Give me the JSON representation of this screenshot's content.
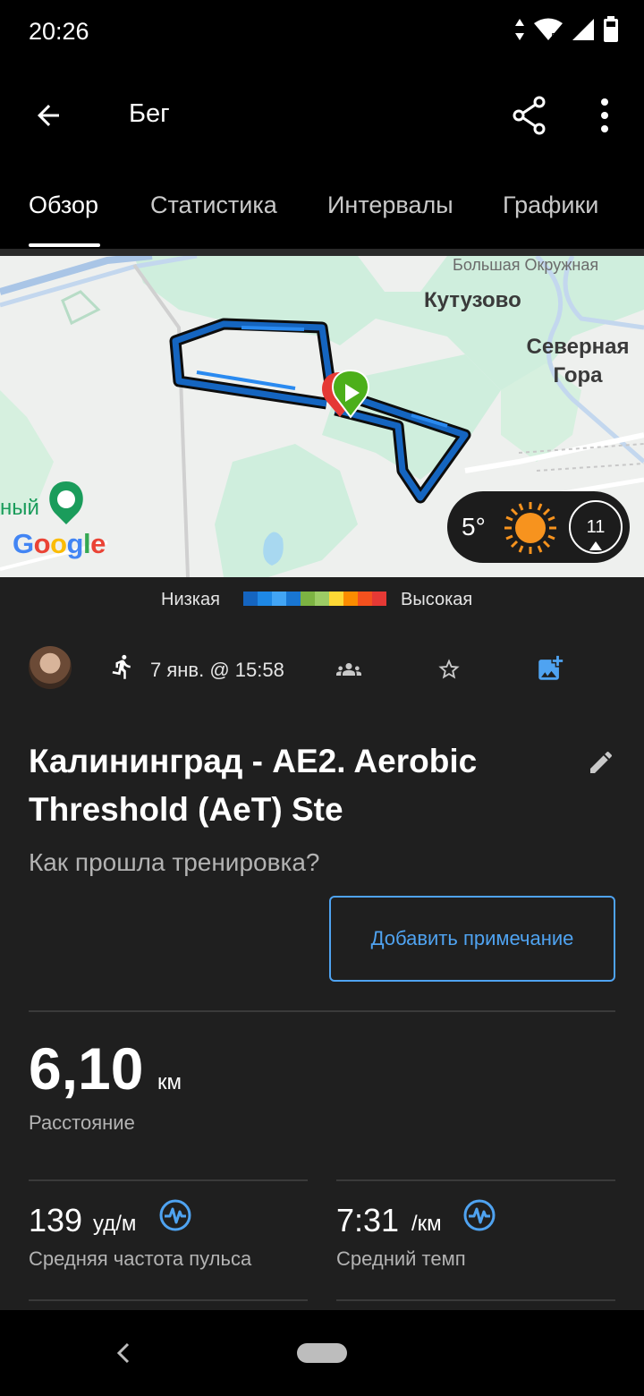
{
  "status_bar": {
    "time": "20:26"
  },
  "app_bar": {
    "title": "Бег"
  },
  "tabs": [
    {
      "label": "Обзор",
      "active": true
    },
    {
      "label": "Статистика",
      "active": false
    },
    {
      "label": "Интервалы",
      "active": false
    },
    {
      "label": "Графики",
      "active": false
    }
  ],
  "map": {
    "labels": {
      "road": "Большая Окружная",
      "kutuzovo": "Кутузово",
      "severnaya_gora": "Северная Гора",
      "partial": "ный"
    },
    "google": [
      "G",
      "o",
      "o",
      "g",
      "l",
      "e"
    ],
    "google_colors": [
      "#4285F4",
      "#EA4335",
      "#FBBC05",
      "#4285F4",
      "#34A853",
      "#EA4335"
    ],
    "weather": {
      "temperature": "5°",
      "wind_speed": "11"
    }
  },
  "legend": {
    "low": "Низкая",
    "high": "Высокая",
    "colors": [
      "#1565c0",
      "#1e88e5",
      "#42a5f5",
      "#1976d2",
      "#7cb342",
      "#9ccc65",
      "#fdd835",
      "#fb8c00",
      "#f4511e",
      "#e53935"
    ]
  },
  "activity": {
    "date": "7 янв. @ 15:58",
    "title": "Калининград - AE2. Aerobic Threshold (AeT) Ste",
    "question": "Как прошла тренировка?",
    "add_note": "Добавить примечание"
  },
  "stats": {
    "distance": {
      "value": "6,10",
      "unit": "км",
      "label": "Расстояние"
    },
    "heart_rate": {
      "value": "139",
      "unit": "уд/м",
      "label": "Средняя частота пульса"
    },
    "pace": {
      "value": "7:31",
      "unit": "/км",
      "label": "Средний темп"
    }
  },
  "colors": {
    "accent": "#4fa3f1",
    "background": "#1f1f1f",
    "route": "#0b57c9",
    "start_marker": "#4caf1a"
  }
}
